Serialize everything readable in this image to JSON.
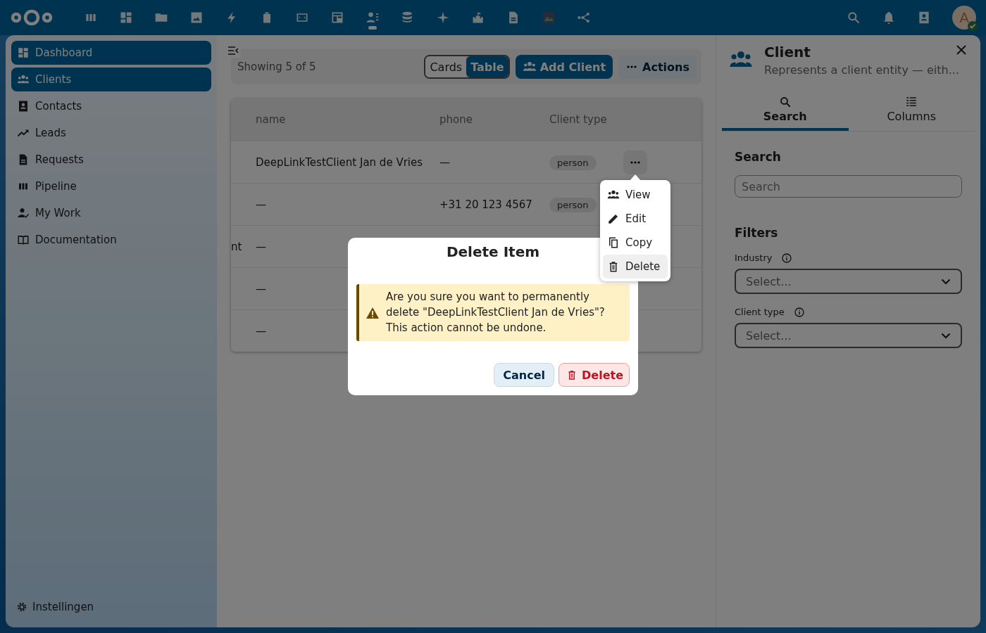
{
  "top_bar": {
    "apps": [
      {
        "kind": "columns",
        "selected": false
      },
      {
        "kind": "grid",
        "selected": false
      },
      {
        "kind": "folder",
        "selected": false
      },
      {
        "kind": "image",
        "selected": false
      },
      {
        "kind": "lightning",
        "selected": false
      },
      {
        "kind": "bag",
        "selected": false
      },
      {
        "kind": "code",
        "selected": false
      },
      {
        "kind": "layout",
        "selected": false
      },
      {
        "kind": "contacts",
        "selected": true
      },
      {
        "kind": "database",
        "selected": false
      },
      {
        "kind": "spark",
        "selected": false
      },
      {
        "kind": "castle",
        "selected": false
      },
      {
        "kind": "document",
        "selected": false
      },
      {
        "kind": "thumbnail",
        "selected": false
      },
      {
        "kind": "share",
        "selected": false
      }
    ],
    "avatar": {
      "initial": "A"
    }
  },
  "sidebar": {
    "items": [
      {
        "label": "Dashboard",
        "kind": "grid",
        "selected": true
      },
      {
        "label": "Clients",
        "kind": "people",
        "selected": true
      },
      {
        "label": "Contacts",
        "kind": "card",
        "selected": false
      },
      {
        "label": "Leads",
        "kind": "trend",
        "selected": false
      },
      {
        "label": "Requests",
        "kind": "document",
        "selected": false
      },
      {
        "label": "Pipeline",
        "kind": "columns",
        "selected": false
      },
      {
        "label": "My Work",
        "kind": "person-check",
        "selected": false
      },
      {
        "label": "Documentation",
        "kind": "book",
        "selected": false
      }
    ],
    "footer": {
      "label": "Instellingen"
    }
  },
  "main": {
    "toolbar": {
      "count_text": "Showing 5 of 5",
      "view_toggle": [
        {
          "label": "Cards",
          "selected": false
        },
        {
          "label": "Table",
          "selected": true
        }
      ],
      "add_button": "Add Client",
      "actions_button": "Actions"
    },
    "table": {
      "columns": [
        "name",
        "phone",
        "Client type"
      ],
      "rows": [
        {
          "name": "DeepLinkTestClient Jan de Vries",
          "phone": "—",
          "client_type": "person",
          "actions_visible": true
        },
        {
          "name": "—",
          "phone": "+31 20 123 4567",
          "client_type": "person"
        },
        {
          "column_1": "nt",
          "name": "—"
        },
        {
          "name": "—"
        },
        {
          "name": "—"
        }
      ]
    },
    "row_menu": {
      "items": [
        {
          "label": "View",
          "kind": "people",
          "highlighted": false
        },
        {
          "label": "Edit",
          "kind": "pencil",
          "highlighted": false
        },
        {
          "label": "Copy",
          "kind": "copy",
          "highlighted": false
        },
        {
          "label": "Delete",
          "kind": "trash",
          "highlighted": true
        }
      ]
    }
  },
  "right_panel": {
    "title": "Client",
    "subtitle": "Represents a client entity — eith...",
    "tabs": [
      {
        "label": "Search",
        "kind": "search",
        "selected": true
      },
      {
        "label": "Columns",
        "kind": "list",
        "selected": false
      }
    ],
    "search": {
      "heading": "Search",
      "placeholder": "Search"
    },
    "filters": {
      "heading": "Filters",
      "fields": [
        {
          "label": "Industry",
          "placeholder": "Select..."
        },
        {
          "label": "Client type",
          "placeholder": "Select..."
        }
      ]
    }
  },
  "dialog": {
    "title": "Delete Item",
    "message": "Are you sure you want to permanently delete \"DeepLinkTestClient Jan de Vries\"? This action cannot be undone.",
    "buttons": [
      {
        "label": "Cancel",
        "kind": "secondary"
      },
      {
        "label": "Delete",
        "kind": "danger"
      }
    ]
  }
}
